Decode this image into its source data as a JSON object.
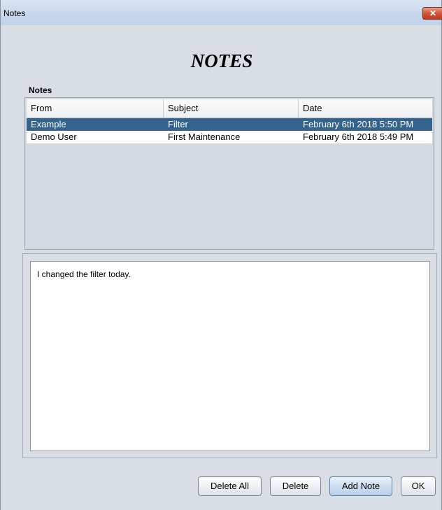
{
  "window": {
    "title": "Notes",
    "close_glyph": "✕"
  },
  "heading": "NOTES",
  "notes_label": "Notes",
  "table": {
    "columns": [
      "From",
      "Subject",
      "Date"
    ],
    "rows": [
      {
        "from": "Example",
        "subject": "Filter",
        "date": "February 6th 2018 5:50 PM",
        "selected": true
      },
      {
        "from": "Demo User",
        "subject": "First Maintenance",
        "date": "February 6th 2018 5:49 PM",
        "selected": false
      }
    ]
  },
  "note_body": "I changed the filter today.",
  "buttons": {
    "delete_all": "Delete All",
    "delete": "Delete",
    "add_note": "Add Note",
    "ok": "OK"
  },
  "colors": {
    "selection": "#34638b",
    "window_bg": "#d9dde4",
    "close_button": "#c0391f"
  }
}
